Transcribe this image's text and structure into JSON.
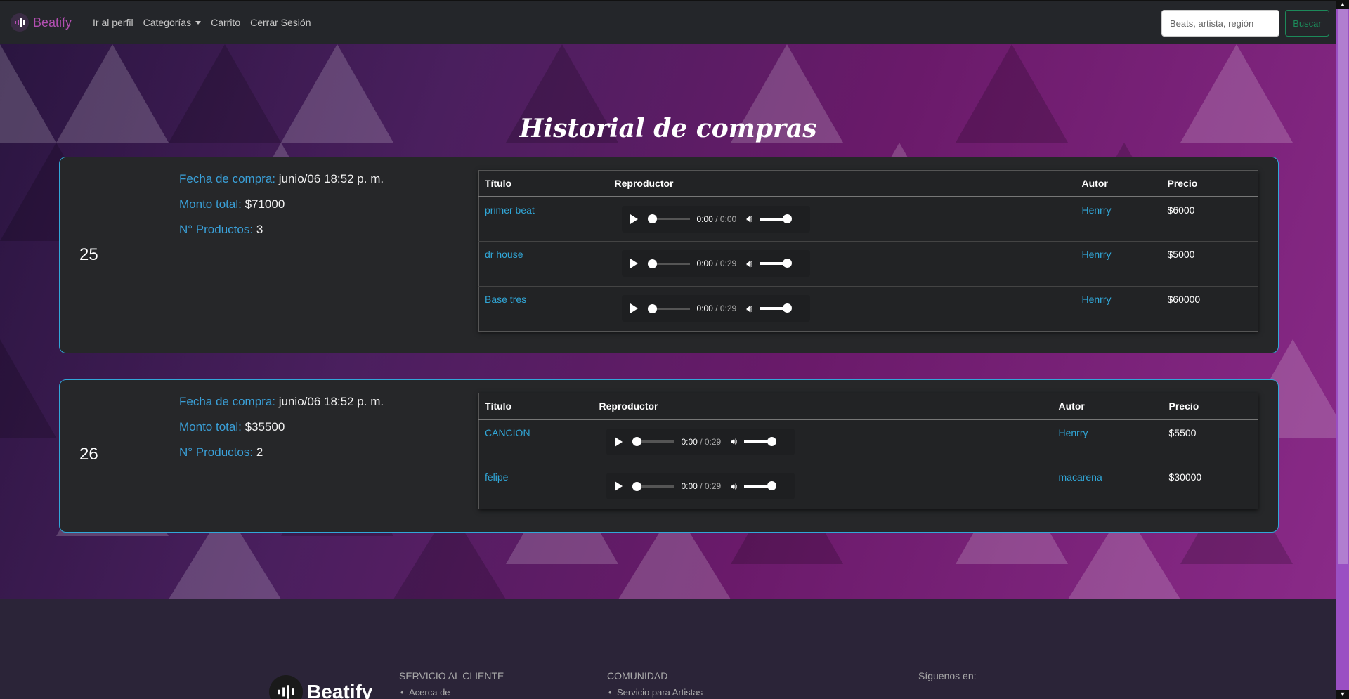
{
  "navbar": {
    "brand": "Beatify",
    "links": [
      "Ir al perfil",
      "Categorías",
      "Carrito",
      "Cerrar Sesión"
    ],
    "search_placeholder": "Beats, artista, región",
    "search_button": "Buscar"
  },
  "page_title": "Historial de compras",
  "labels": {
    "fecha": "Fecha de compra:",
    "monto": "Monto total:",
    "productos": "N° Productos:"
  },
  "table_headers": {
    "titulo": "Título",
    "reproductor": "Reproductor",
    "autor": "Autor",
    "precio": "Precio"
  },
  "orders": [
    {
      "id": "25",
      "fecha": "junio/06 18:52 p. m.",
      "monto": "$71000",
      "productos": "3",
      "items": [
        {
          "titulo": "primer beat",
          "time": "0:00",
          "duration": "0:00",
          "autor": "Henrry",
          "precio": "$6000"
        },
        {
          "titulo": "dr house",
          "time": "0:00",
          "duration": "0:29",
          "autor": "Henrry",
          "precio": "$5000"
        },
        {
          "titulo": "Base tres",
          "time": "0:00",
          "duration": "0:29",
          "autor": "Henrry",
          "precio": "$60000"
        }
      ]
    },
    {
      "id": "26",
      "fecha": "junio/06 18:52 p. m.",
      "monto": "$35500",
      "productos": "2",
      "items": [
        {
          "titulo": "CANCION",
          "time": "0:00",
          "duration": "0:29",
          "autor": "Henrry",
          "precio": "$5500"
        },
        {
          "titulo": "felipe",
          "time": "0:00",
          "duration": "0:29",
          "autor": "macarena",
          "precio": "$30000"
        }
      ]
    }
  ],
  "footer": {
    "brand": "Beatify",
    "servicio": {
      "head": "SERVICIO AL CLIENTE",
      "items": [
        "Acerca de"
      ]
    },
    "comunidad": {
      "head": "COMUNIDAD",
      "items": [
        "Servicio para Artistas"
      ]
    },
    "social": {
      "head": "Síguenos en:"
    }
  },
  "icons": {
    "logo": "sound-wave-icon",
    "play": "play-icon",
    "volume": "volume-icon",
    "caret": "caret-down-icon"
  },
  "colors": {
    "accent": "#31a7d8",
    "brand": "#b24fb1",
    "success": "#1c8a5a"
  }
}
